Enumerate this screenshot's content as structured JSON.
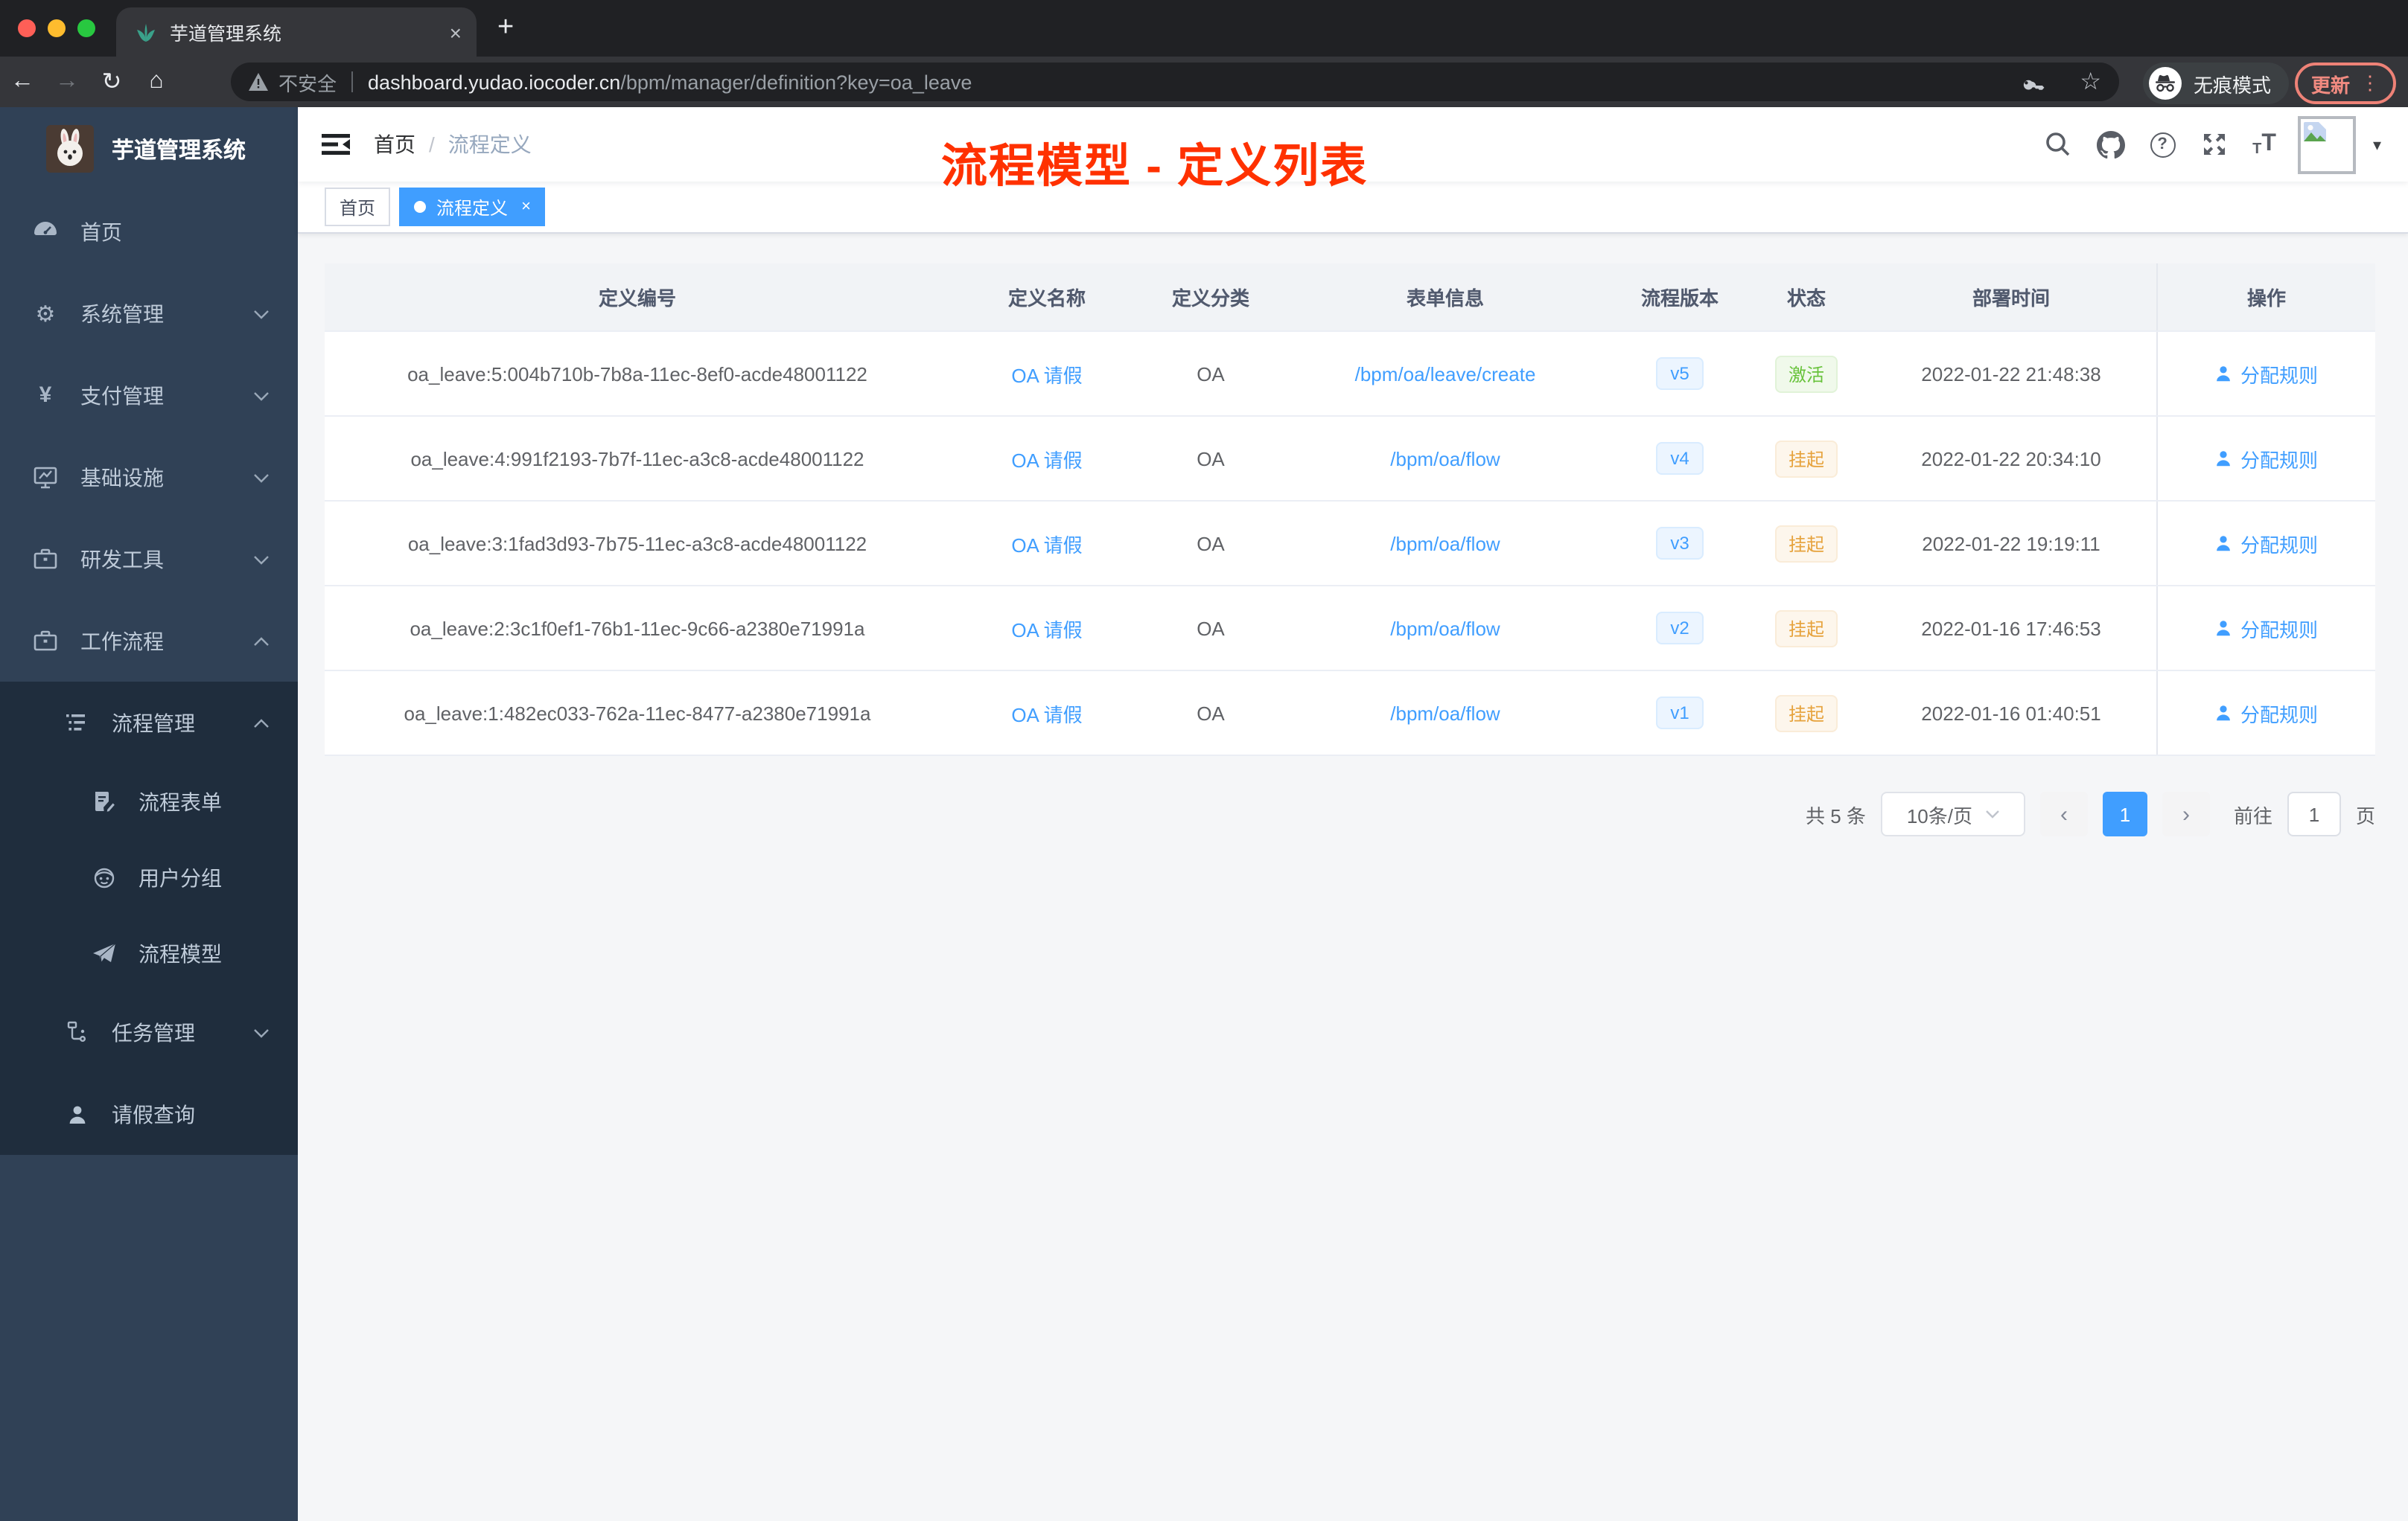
{
  "theme": {
    "accent": "#409eff",
    "annotation_color": "#ff3100",
    "success": "#67c23a",
    "warning": "#e6a23c",
    "sidebar_bg": "#304156",
    "submenu_bg": "#1f2d3d"
  },
  "icons": {
    "back": "←",
    "forward": "→",
    "reload": "↻",
    "home": "⌂",
    "star": "☆",
    "gear": "⚙",
    "yen": "¥",
    "plus": "+",
    "close": "×",
    "tag_close": "×",
    "caret_down": "▾",
    "more_vert": "⋮",
    "help": "?",
    "font_small": "T",
    "font_big": "T"
  },
  "browser": {
    "tab_title": "芋道管理系统",
    "security_label": "不安全",
    "url_host": "dashboard.yudao.iocoder.cn",
    "url_path": "/bpm/manager/definition?key=oa_leave",
    "incognito_label": "无痕模式",
    "update_label": "更新"
  },
  "sidebar": {
    "app_title": "芋道管理系统",
    "items": [
      {
        "label": "首页"
      },
      {
        "label": "系统管理",
        "chevron": "down"
      },
      {
        "label": "支付管理",
        "chevron": "down"
      },
      {
        "label": "基础设施",
        "chevron": "down"
      },
      {
        "label": "研发工具",
        "chevron": "down"
      },
      {
        "label": "工作流程",
        "chevron": "up"
      },
      {
        "label": "流程管理",
        "chevron": "up"
      },
      {
        "label": "流程表单"
      },
      {
        "label": "用户分组"
      },
      {
        "label": "流程模型"
      },
      {
        "label": "任务管理",
        "chevron": "down"
      },
      {
        "label": "请假查询"
      }
    ]
  },
  "header": {
    "breadcrumb_home": "首页",
    "breadcrumb_sep": "/",
    "breadcrumb_current": "流程定义",
    "annotation": "流程模型 - 定义列表"
  },
  "tags": [
    {
      "label": "首页",
      "active": false
    },
    {
      "label": "流程定义",
      "active": true
    }
  ],
  "table": {
    "columns": [
      "定义编号",
      "定义名称",
      "定义分类",
      "表单信息",
      "流程版本",
      "状态",
      "部署时间",
      "操作"
    ],
    "rows": [
      {
        "id": "oa_leave:5:004b710b-7b8a-11ec-8ef0-acde48001122",
        "name": "OA 请假",
        "category": "OA",
        "form": "/bpm/oa/leave/create",
        "version": "v5",
        "status": "激活",
        "status_type": "success",
        "deploy_time": "2022-01-22 21:48:38",
        "action": "分配规则"
      },
      {
        "id": "oa_leave:4:991f2193-7b7f-11ec-a3c8-acde48001122",
        "name": "OA 请假",
        "category": "OA",
        "form": "/bpm/oa/flow",
        "version": "v4",
        "status": "挂起",
        "status_type": "warning",
        "deploy_time": "2022-01-22 20:34:10",
        "action": "分配规则"
      },
      {
        "id": "oa_leave:3:1fad3d93-7b75-11ec-a3c8-acde48001122",
        "name": "OA 请假",
        "category": "OA",
        "form": "/bpm/oa/flow",
        "version": "v3",
        "status": "挂起",
        "status_type": "warning",
        "deploy_time": "2022-01-22 19:19:11",
        "action": "分配规则"
      },
      {
        "id": "oa_leave:2:3c1f0ef1-76b1-11ec-9c66-a2380e71991a",
        "name": "OA 请假",
        "category": "OA",
        "form": "/bpm/oa/flow",
        "version": "v2",
        "status": "挂起",
        "status_type": "warning",
        "deploy_time": "2022-01-16 17:46:53",
        "action": "分配规则"
      },
      {
        "id": "oa_leave:1:482ec033-762a-11ec-8477-a2380e71991a",
        "name": "OA 请假",
        "category": "OA",
        "form": "/bpm/oa/flow",
        "version": "v1",
        "status": "挂起",
        "status_type": "warning",
        "deploy_time": "2022-01-16 01:40:51",
        "action": "分配规则"
      }
    ]
  },
  "pagination": {
    "total_label": "共 5 条",
    "page_size": "10条/页",
    "prev": "‹",
    "current_page": "1",
    "next": "›",
    "goto_label": "前往",
    "goto_value": "1",
    "goto_suffix": "页"
  }
}
